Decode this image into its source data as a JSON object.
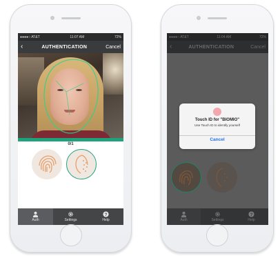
{
  "left_phone": {
    "status_bar": {
      "carrier": "●●●●○ AT&T",
      "time": "11:07 AM",
      "battery": "72%"
    },
    "nav": {
      "back_icon": "chevron-left-icon",
      "title": "AUTHENTICATION",
      "cancel": "Cancel"
    },
    "progress_counter": "0/1",
    "methods": [
      "fingerprint",
      "face"
    ],
    "tabs": [
      {
        "label": "Auth",
        "icon": "user-icon"
      },
      {
        "label": "Settings",
        "icon": "gear-icon"
      },
      {
        "label": "Help",
        "icon": "help-icon"
      }
    ]
  },
  "right_phone": {
    "status_bar": {
      "carrier": "●●●●○ AT&T",
      "time": "11:04 AM",
      "battery": "72%"
    },
    "nav": {
      "back_icon": "chevron-left-icon",
      "title": "AUTHENTICATION",
      "cancel": "Cancel"
    },
    "alert": {
      "title": "Touch ID for \"BIOMIO\"",
      "subtitle": "Use Touch ID to identify yourself",
      "cancel": "Cancel"
    },
    "tabs": [
      {
        "label": "Auth",
        "icon": "user-icon"
      },
      {
        "label": "Settings",
        "icon": "gear-icon"
      },
      {
        "label": "Help",
        "icon": "help-icon"
      }
    ]
  },
  "colors": {
    "accent": "#1fa37d",
    "nav": "#3a3b3d",
    "link": "#1b6ff2",
    "fingerprint": "#e8a06a"
  }
}
